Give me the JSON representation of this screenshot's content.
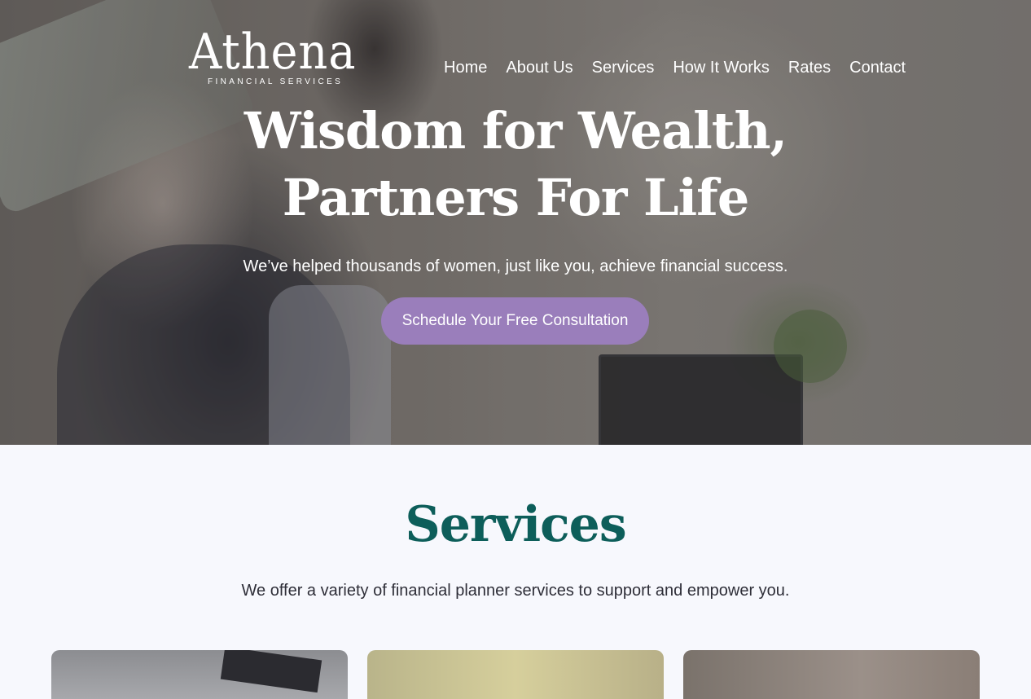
{
  "brand": {
    "name": "Athena",
    "tagline": "FINANCIAL SERVICES"
  },
  "nav": {
    "items": [
      {
        "label": "Home"
      },
      {
        "label": "About Us"
      },
      {
        "label": "Services"
      },
      {
        "label": "How It Works"
      },
      {
        "label": "Rates"
      },
      {
        "label": "Contact"
      }
    ]
  },
  "hero": {
    "title_line1": "Wisdom for Wealth,",
    "title_line2": "Partners For Life",
    "subtitle": "We’ve helped thousands of women, just like you, achieve financial success.",
    "cta_label": "Schedule Your Free Consultation"
  },
  "services": {
    "title": "Services",
    "subtitle": "We offer a variety of financial planner services to support and empower you."
  },
  "colors": {
    "accent": "#9a7ebb",
    "heading_teal": "#0d5e5a",
    "page_background": "#f7f8fd"
  }
}
